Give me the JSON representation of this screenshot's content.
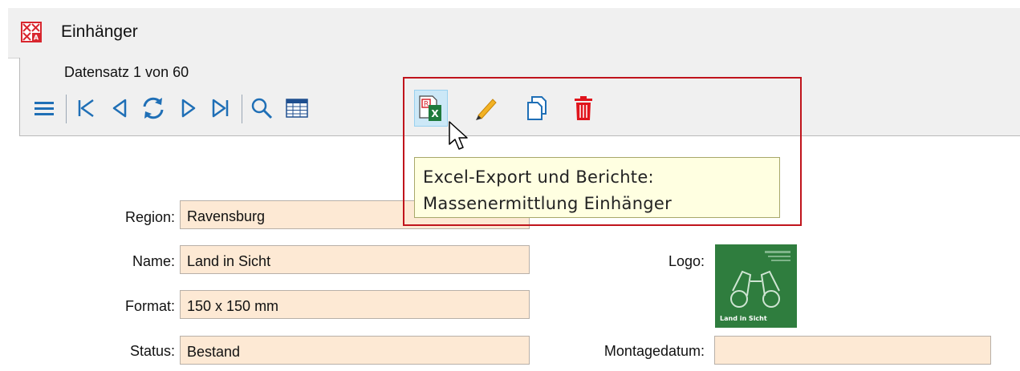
{
  "window": {
    "title": "Einhänger"
  },
  "toolbar": {
    "record_status": "Datensatz 1 von 60",
    "buttons": [
      {
        "name": "menu-icon"
      },
      {
        "name": "first-record-icon"
      },
      {
        "name": "previous-record-icon"
      },
      {
        "name": "refresh-icon"
      },
      {
        "name": "next-record-icon"
      },
      {
        "name": "last-record-icon"
      },
      {
        "name": "search-icon"
      },
      {
        "name": "table-view-icon"
      },
      {
        "name": "excel-export-icon",
        "state": "hover"
      },
      {
        "name": "edit-pencil-icon"
      },
      {
        "name": "copy-icon"
      },
      {
        "name": "delete-trash-icon"
      }
    ]
  },
  "tooltip": {
    "line1": "Excel-Export und Berichte:",
    "line2": "Massenermittlung Einhänger"
  },
  "form": {
    "region_label": "Region:",
    "region_value": "Ravensburg",
    "name_label": "Name:",
    "name_value": "Land in Sicht",
    "format_label": "Format:",
    "format_value": "150 x 150 mm",
    "status_label": "Status:",
    "status_value": "Bestand",
    "logo_label": "Logo:",
    "logo_caption": "Land in Sicht",
    "montagedatum_label": "Montagedatum:",
    "montagedatum_value": ""
  },
  "colors": {
    "field_bg": "#fde9d4",
    "highlight_border": "#c0141c",
    "tooltip_bg": "#ffffe1",
    "icon_blue": "#1f6fb6",
    "delete_red": "#e0141c",
    "logo_green": "#2f7d3e"
  }
}
